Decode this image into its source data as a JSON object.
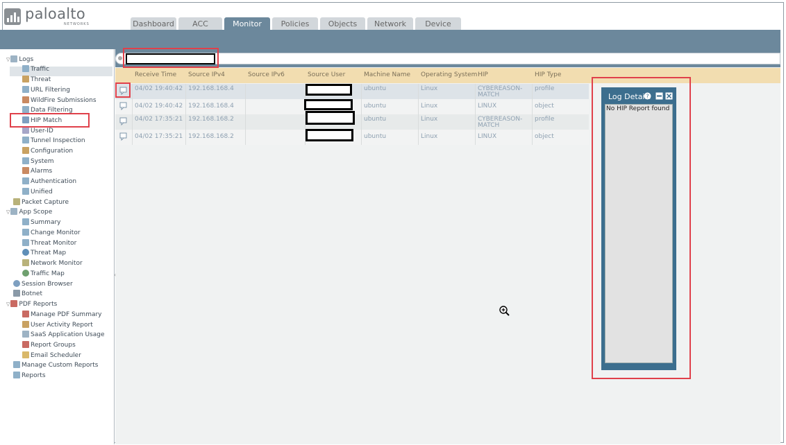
{
  "brand": {
    "name": "paloalto",
    "sub": "NETWORKS"
  },
  "tabs": [
    {
      "label": "Dashboard",
      "active": false
    },
    {
      "label": "ACC",
      "active": false
    },
    {
      "label": "Monitor",
      "active": true
    },
    {
      "label": "Policies",
      "active": false
    },
    {
      "label": "Objects",
      "active": false
    },
    {
      "label": "Network",
      "active": false
    },
    {
      "label": "Device",
      "active": false
    }
  ],
  "nav": {
    "logs": "Logs",
    "traffic": "Traffic",
    "threat": "Threat",
    "url_filtering": "URL Filtering",
    "wildfire": "WildFire Submissions",
    "data_filtering": "Data Filtering",
    "hip_match": "HIP Match",
    "user_id": "User-ID",
    "tunnel": "Tunnel Inspection",
    "configuration": "Configuration",
    "system": "System",
    "alarms": "Alarms",
    "authentication": "Authentication",
    "unified": "Unified",
    "packet_capture": "Packet Capture",
    "app_scope": "App Scope",
    "summary": "Summary",
    "change_monitor": "Change Monitor",
    "threat_monitor": "Threat Monitor",
    "threat_map": "Threat Map",
    "network_monitor": "Network Monitor",
    "traffic_map": "Traffic Map",
    "session_browser": "Session Browser",
    "botnet": "Botnet",
    "pdf_reports": "PDF Reports",
    "manage_pdf": "Manage PDF Summary",
    "user_activity": "User Activity Report",
    "saas_usage": "SaaS Application Usage",
    "report_groups": "Report Groups",
    "email_scheduler": "Email Scheduler",
    "manage_custom": "Manage Custom Reports",
    "reports": "Reports"
  },
  "table": {
    "headers": {
      "receive_time": "Receive Time",
      "source_ipv4": "Source IPv4",
      "source_ipv6": "Source IPv6",
      "source_user": "Source User",
      "machine_name": "Machine Name",
      "os": "Operating System",
      "hip": "HIP",
      "hip_type": "HIP Type"
    },
    "rows": [
      {
        "time": "04/02 19:40:42",
        "ipv4": "192.168.168.4",
        "machine": "ubuntu",
        "os": "Linux",
        "hip1": "CYBEREASON-",
        "hip2": "MATCH",
        "type": "profile"
      },
      {
        "time": "04/02 19:40:42",
        "ipv4": "192.168.168.4",
        "machine": "ubuntu",
        "os": "Linux",
        "hip1": "LINUX",
        "hip2": "",
        "type": "object"
      },
      {
        "time": "04/02 17:35:21",
        "ipv4": "192.168.168.2",
        "machine": "ubuntu",
        "os": "Linux",
        "hip1": "CYBEREASON-",
        "hip2": "MATCH",
        "type": "profile"
      },
      {
        "time": "04/02 17:35:21",
        "ipv4": "192.168.168.2",
        "machine": "ubuntu",
        "os": "Linux",
        "hip1": "LINUX",
        "hip2": "",
        "type": "object"
      }
    ]
  },
  "log_details": {
    "title": "Log Details",
    "message": "No HIP Report found"
  },
  "colors": {
    "header_blue": "#6c889c",
    "panel_blue": "#3c6e8e",
    "table_header": "#f2ddb0",
    "highlight_red": "#e0404a"
  }
}
